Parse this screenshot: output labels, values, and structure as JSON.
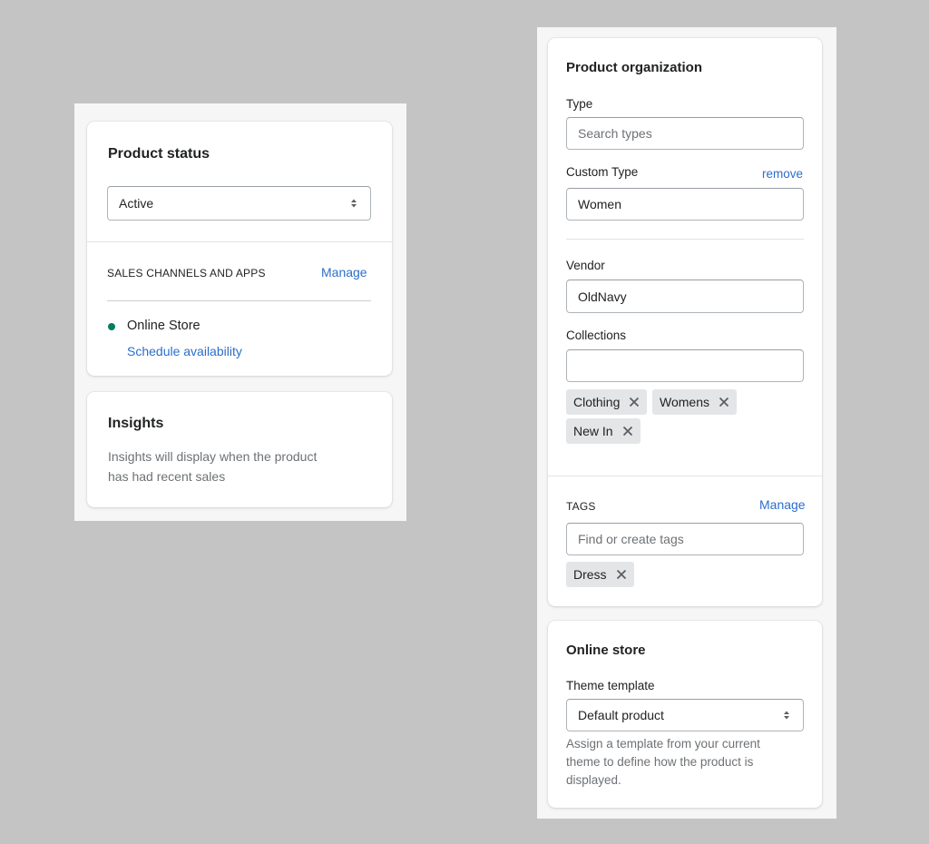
{
  "product_status": {
    "title": "Product status",
    "status_value": "Active",
    "sales_channels_heading": "SALES CHANNELS AND APPS",
    "manage_label": "Manage",
    "channel_name": "Online Store",
    "schedule_label": "Schedule availability",
    "channel_status_color": "#007f5f"
  },
  "insights": {
    "title": "Insights",
    "line1": "Insights will display when the product",
    "line2": "has had recent sales"
  },
  "organization": {
    "title": "Product organization",
    "type_label": "Type",
    "type_placeholder": "Search types",
    "custom_type_label": "Custom Type",
    "remove_label": "remove",
    "custom_type_value": "Women",
    "vendor_label": "Vendor",
    "vendor_value": "OldNavy",
    "collections_label": "Collections",
    "collections_value": "",
    "collections": [
      "Clothing",
      "Womens",
      "New In"
    ]
  },
  "tags": {
    "heading": "TAGS",
    "manage_label": "Manage",
    "placeholder": "Find or create tags",
    "items": [
      "Dress"
    ]
  },
  "online_store": {
    "title": "Online store",
    "template_label": "Theme template",
    "template_value": "Default product",
    "help_line1": "Assign a template from your current",
    "help_line2": "theme to define how the product is",
    "help_line3": "displayed."
  },
  "colors": {
    "link": "#2c6ecb",
    "background": "#c4c4c4",
    "panel": "#f6f6f7"
  }
}
